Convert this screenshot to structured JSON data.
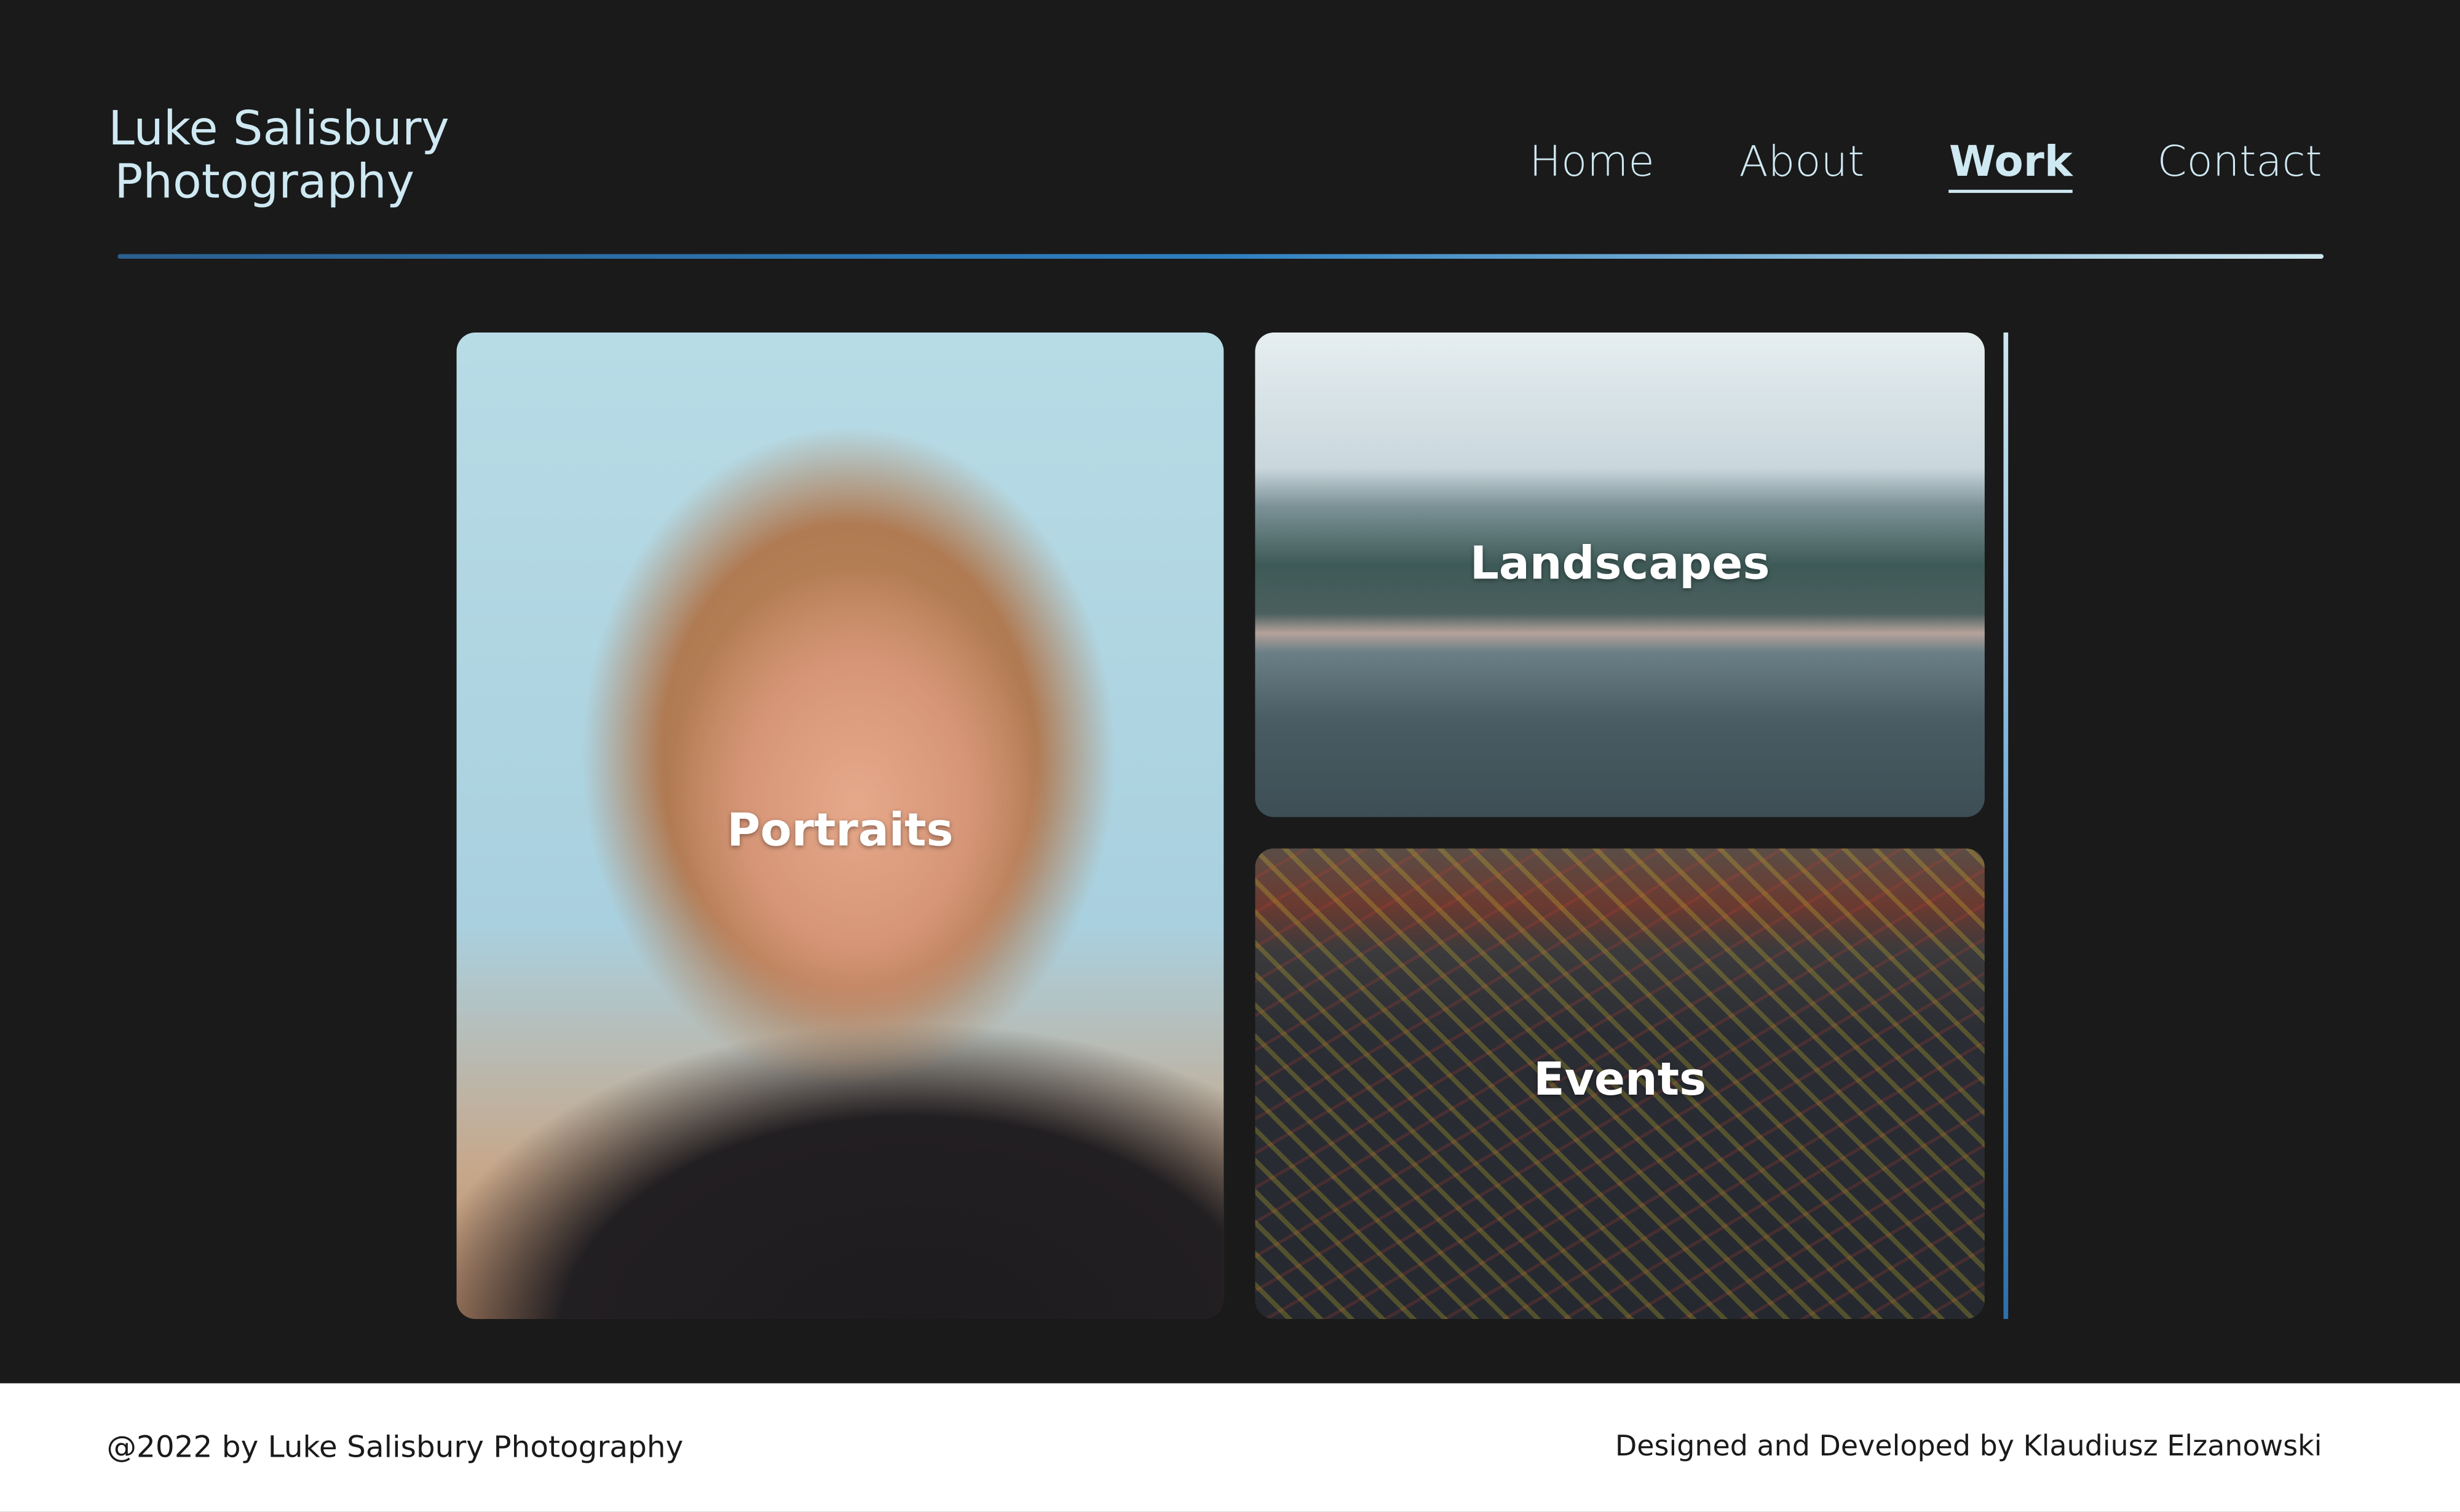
{
  "header": {
    "logo_line1": "Luke Salisbury",
    "logo_line2": "Photography"
  },
  "nav": {
    "items": [
      {
        "label": "Home"
      },
      {
        "label": "About"
      },
      {
        "label": "Work",
        "active": true
      },
      {
        "label": "Contact"
      }
    ]
  },
  "gallery": {
    "cards": [
      {
        "label": "Portraits"
      },
      {
        "label": "Landscapes"
      },
      {
        "label": "Events"
      }
    ]
  },
  "footer": {
    "copyright": "@2022 by Luke Salisbury Photography",
    "credit": "Designed and Developed by Klaudiusz Elzanowski"
  },
  "colors": {
    "background": "#1a1a1a",
    "accent": "#cfe9f3",
    "divider_start": "#2b5f8f",
    "divider_end": "#cde7ee"
  }
}
